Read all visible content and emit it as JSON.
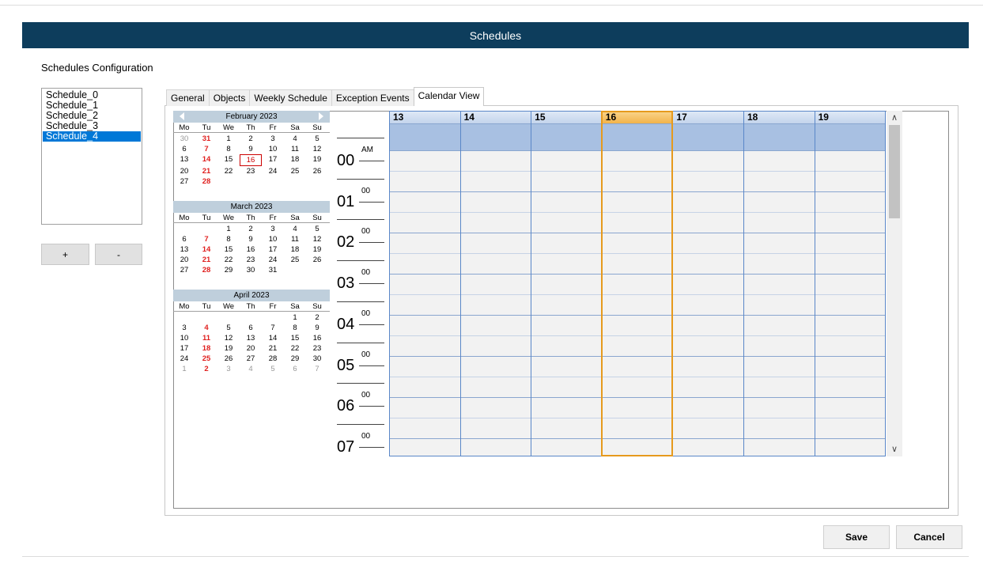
{
  "window": {
    "title": "Schedules"
  },
  "page": {
    "heading": "Schedules Configuration"
  },
  "schedules": {
    "items": [
      "Schedule_0",
      "Schedule_1",
      "Schedule_2",
      "Schedule_3",
      "Schedule_4"
    ],
    "selected_index": 4
  },
  "list_buttons": {
    "add_label": "+",
    "remove_label": "-"
  },
  "tabs": [
    {
      "label": "General",
      "active": false
    },
    {
      "label": "Objects",
      "active": false
    },
    {
      "label": "Weekly Schedule",
      "active": false
    },
    {
      "label": "Exception Events",
      "active": false
    },
    {
      "label": "Calendar View",
      "active": true
    }
  ],
  "mini_calendars": {
    "dow": [
      "Mo",
      "Tu",
      "We",
      "Th",
      "Fr",
      "Sa",
      "Su"
    ],
    "months": [
      {
        "title": "February 2023",
        "has_nav": true,
        "weeks": [
          [
            "30",
            "31",
            "1",
            "2",
            "3",
            "4",
            "5"
          ],
          [
            "6",
            "7",
            "8",
            "9",
            "10",
            "11",
            "12"
          ],
          [
            "13",
            "14",
            "15",
            "16",
            "17",
            "18",
            "19"
          ],
          [
            "20",
            "21",
            "22",
            "23",
            "24",
            "25",
            "26"
          ],
          [
            "27",
            "28",
            "",
            "",
            "",
            "",
            ""
          ]
        ]
      },
      {
        "title": "March 2023",
        "has_nav": false,
        "weeks": [
          [
            "",
            "",
            "1",
            "2",
            "3",
            "4",
            "5"
          ],
          [
            "6",
            "7",
            "8",
            "9",
            "10",
            "11",
            "12"
          ],
          [
            "13",
            "14",
            "15",
            "16",
            "17",
            "18",
            "19"
          ],
          [
            "20",
            "21",
            "22",
            "23",
            "24",
            "25",
            "26"
          ],
          [
            "27",
            "28",
            "29",
            "30",
            "31",
            "",
            ""
          ]
        ]
      },
      {
        "title": "April 2023",
        "has_nav": false,
        "weeks": [
          [
            "",
            "",
            "",
            "",
            "",
            "1",
            "2"
          ],
          [
            "3",
            "4",
            "5",
            "6",
            "7",
            "8",
            "9"
          ],
          [
            "10",
            "11",
            "12",
            "13",
            "14",
            "15",
            "16"
          ],
          [
            "17",
            "18",
            "19",
            "20",
            "21",
            "22",
            "23"
          ],
          [
            "24",
            "25",
            "26",
            "27",
            "28",
            "29",
            "30"
          ],
          [
            "1",
            "2",
            "3",
            "4",
            "5",
            "6",
            "7"
          ]
        ]
      }
    ],
    "today": "16"
  },
  "time_scale": {
    "am_label": "AM",
    "hours": [
      "00",
      "01",
      "02",
      "03",
      "04",
      "05",
      "06",
      "07"
    ],
    "minutes": "00"
  },
  "day_view": {
    "days": [
      "13",
      "14",
      "15",
      "16",
      "17",
      "18",
      "19"
    ],
    "today": "16"
  },
  "scrollbar": {
    "up_icon": "chevron-up-icon",
    "down_icon": "chevron-down-icon"
  },
  "footer": {
    "save_label": "Save",
    "cancel_label": "Cancel"
  },
  "colors": {
    "title_bar": "#0d3d5c",
    "selection": "#0078d7",
    "today_outline": "#e69a1d",
    "holiday_red": "#e0201f",
    "allday_band": "#a8c0e2"
  }
}
